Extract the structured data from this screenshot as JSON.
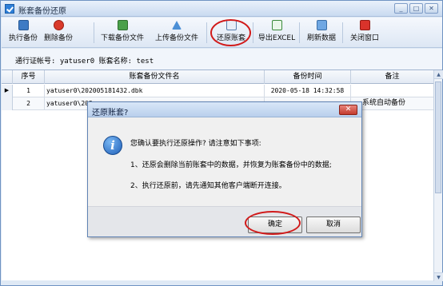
{
  "window": {
    "title": "账套备份还原",
    "controls": [
      "_",
      "□",
      "✕"
    ]
  },
  "toolbar": {
    "buttons": [
      {
        "label": "执行备份",
        "icon": "save-disk-icon"
      },
      {
        "label": "删除备份",
        "icon": "delete-icon"
      },
      {
        "label": "下载备份文件",
        "icon": "download-file-icon"
      },
      {
        "label": "上传备份文件",
        "icon": "upload-arrow-icon"
      },
      {
        "label": "还原账套",
        "icon": "restore-icon"
      },
      {
        "label": "导出EXCEL",
        "icon": "excel-export-icon"
      },
      {
        "label": "刷新数据",
        "icon": "refresh-icon"
      },
      {
        "label": "关闭窗口",
        "icon": "close-window-icon"
      }
    ]
  },
  "info": {
    "text": "通行证帐号: yatuser0  账套名称: test"
  },
  "table": {
    "columns": [
      "序号",
      "账套备份文件名",
      "备份时间",
      "备注"
    ],
    "rows": [
      {
        "indicator": "▶",
        "index": "1",
        "file": "yatuser0\\202005181432.dbk",
        "time": "2020-05-18 14:32:58",
        "note": ""
      },
      {
        "indicator": "",
        "index": "2",
        "file": "yatuser0\\202",
        "time": "",
        "note": "系统自动备份"
      }
    ]
  },
  "dialog": {
    "title": "还原账套?",
    "close": "✕",
    "question": "您确认要执行还原操作? 请注意如下事项:",
    "item1": "1、还原会删除当前账套中的数据，并恢复为账套备份中的数据;",
    "item2": "2、执行还原前，请先通知其他客户端断开连接。",
    "ok_label": "确定",
    "cancel_label": "取消",
    "icon_glyph": "i"
  },
  "scrollbar": {
    "up": "▲",
    "down": "▼"
  },
  "colors": {
    "highlight": "#d11a1a",
    "accent": "#2e7fd8"
  }
}
